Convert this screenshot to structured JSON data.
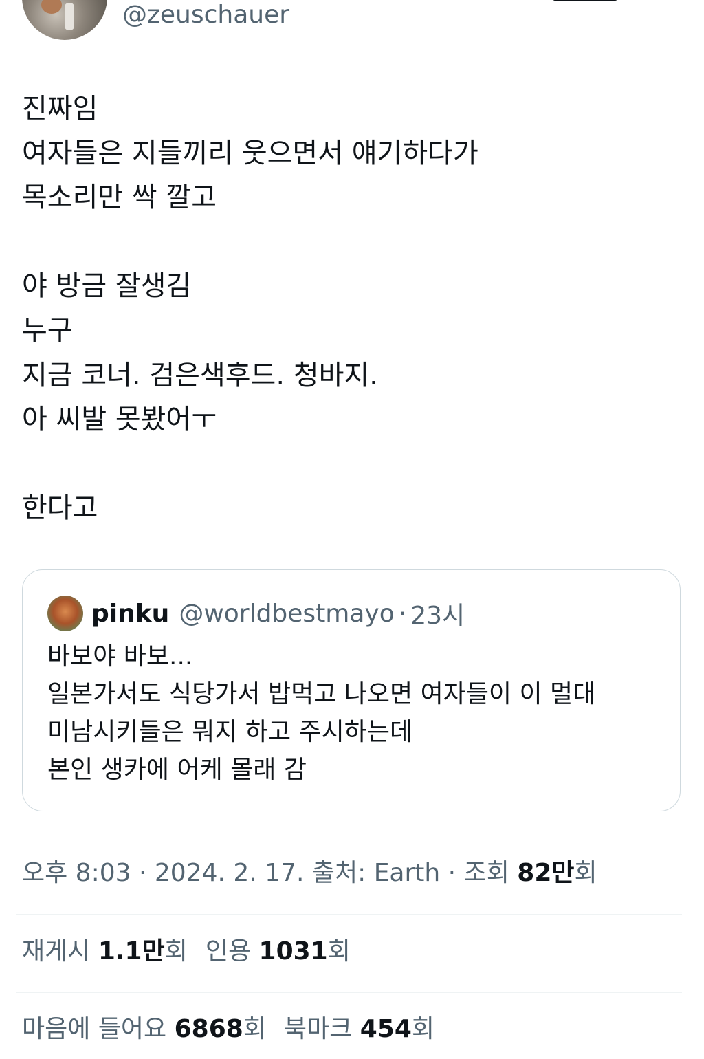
{
  "author": {
    "handle": "@zeuschauer"
  },
  "tweet": {
    "lines": [
      "진짜임",
      "여자들은 지들끼리 웃으면서 얘기하다가",
      "목소리만 싹 깔고",
      "",
      "야 방금 잘생김",
      "누구",
      "지금 코너. 검은색후드. 청바지.",
      "아 씨발 못봤어ㅜ",
      "",
      "한다고"
    ]
  },
  "quote": {
    "name": "pinku",
    "handle": "@worldbestmayo",
    "separator": "·",
    "time": "23시",
    "lines": [
      "바보야 바보...",
      "일본가서도 식당가서 밥먹고 나오면 여자들이 이 멀대",
      "미남시키들은 뭐지 하고 주시하는데",
      "본인 생카에 어케 몰래 감"
    ]
  },
  "meta": {
    "time": "오후 8:03",
    "sep1": " · ",
    "date": "2024. 2. 17.",
    "source_label": " 출처: ",
    "source": "Earth",
    "sep2": " · ",
    "views_label": "조회 ",
    "views_value": "82만",
    "views_suffix": "회"
  },
  "stats": {
    "reposts_label": "재게시 ",
    "reposts_value": "1.1만",
    "reposts_suffix": "회",
    "quotes_label": "인용 ",
    "quotes_value": "1031",
    "quotes_suffix": "회",
    "likes_label": "마음에 들어요 ",
    "likes_value": "6868",
    "likes_suffix": "회",
    "bookmarks_label": "북마크 ",
    "bookmarks_value": "454",
    "bookmarks_suffix": "회"
  }
}
